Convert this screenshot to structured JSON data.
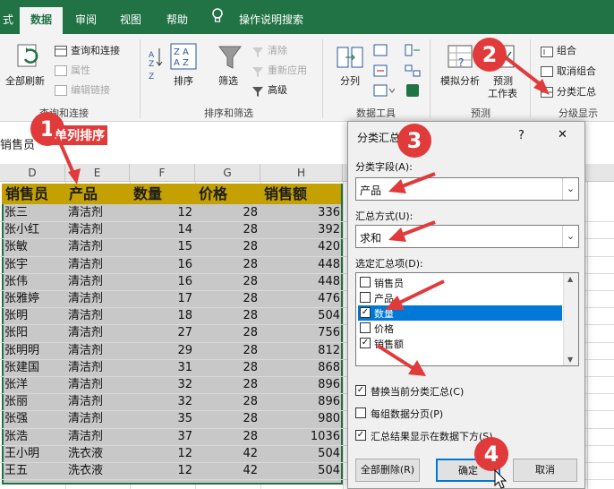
{
  "tabs": [
    "式",
    "数据",
    "审阅",
    "视图",
    "帮助",
    "操作说明搜索"
  ],
  "active_tab": "数据",
  "ribbon": {
    "refresh_all": "全部刷新",
    "queries_connections": "查询和连接",
    "properties": "属性",
    "edit_links": "编辑链接",
    "group_queries": "查询和连接",
    "sort": "排序",
    "filter": "筛选",
    "clear": "清除",
    "reapply": "重新应用",
    "advanced": "高级",
    "group_sort": "排序和筛选",
    "split_columns": "分列",
    "group_data_tools": "数据工具",
    "what_if": "模拟分析",
    "forecast_sheet": "预测\n工作表",
    "forecast_sheet_1": "预测",
    "forecast_sheet_2": "工作表",
    "group_forecast": "预测",
    "group": "组合",
    "ungroup": "取消组合",
    "subtotal": "分类汇总",
    "group_outline": "分级显示"
  },
  "name_box_text": "销售员",
  "columns": [
    "D",
    "E",
    "F",
    "G",
    "H"
  ],
  "headers": [
    "销售员",
    "产品",
    "数量",
    "价格",
    "销售额"
  ],
  "rows": [
    [
      "张三",
      "清洁剂",
      "12",
      "28",
      "336"
    ],
    [
      "张小红",
      "清洁剂",
      "14",
      "28",
      "392"
    ],
    [
      "张敏",
      "清洁剂",
      "15",
      "28",
      "420"
    ],
    [
      "张宇",
      "清洁剂",
      "16",
      "28",
      "448"
    ],
    [
      "张伟",
      "清洁剂",
      "16",
      "28",
      "448"
    ],
    [
      "张雅婷",
      "清洁剂",
      "17",
      "28",
      "476"
    ],
    [
      "张明",
      "清洁剂",
      "18",
      "28",
      "504"
    ],
    [
      "张阳",
      "清洁剂",
      "27",
      "28",
      "756"
    ],
    [
      "张明明",
      "清洁剂",
      "29",
      "28",
      "812"
    ],
    [
      "张建国",
      "清洁剂",
      "31",
      "28",
      "868"
    ],
    [
      "张洋",
      "清洁剂",
      "32",
      "28",
      "896"
    ],
    [
      "张丽",
      "清洁剂",
      "32",
      "28",
      "896"
    ],
    [
      "张强",
      "清洁剂",
      "35",
      "28",
      "980"
    ],
    [
      "张浩",
      "清洁剂",
      "37",
      "28",
      "1036"
    ],
    [
      "王小明",
      "洗衣液",
      "12",
      "42",
      "504"
    ],
    [
      "王五",
      "洗衣液",
      "12",
      "42",
      "504"
    ]
  ],
  "dialog": {
    "title": "分类汇总",
    "help": "?",
    "close": "✕",
    "field_label": "分类字段(A):",
    "field_value": "产品",
    "func_label": "汇总方式(U):",
    "func_value": "求和",
    "items_label": "选定汇总项(D):",
    "items": [
      {
        "label": "销售员",
        "checked": false,
        "highlighted": false
      },
      {
        "label": "产品",
        "checked": false,
        "highlighted": false
      },
      {
        "label": "数量",
        "checked": true,
        "highlighted": true
      },
      {
        "label": "价格",
        "checked": false,
        "highlighted": false
      },
      {
        "label": "销售额",
        "checked": true,
        "highlighted": false
      }
    ],
    "replace_label": "替换当前分类汇总(C)",
    "replace_checked": true,
    "pagebreak_label": "每组数据分页(P)",
    "pagebreak_checked": false,
    "below_label": "汇总结果显示在数据下方(S)",
    "below_checked": true,
    "remove_all": "全部删除(R)",
    "ok": "确定",
    "cancel": "取消"
  },
  "annotations": {
    "step1": "1",
    "step1_text": "单列排序",
    "step2": "2",
    "step3": "3",
    "step4": "4",
    "color": "#e03a3a"
  },
  "colors": {
    "excel_green": "#217346",
    "header_gold": "#c4a000",
    "selection_gray": "#c8c8c8",
    "dialog_highlight": "#0078d7"
  }
}
